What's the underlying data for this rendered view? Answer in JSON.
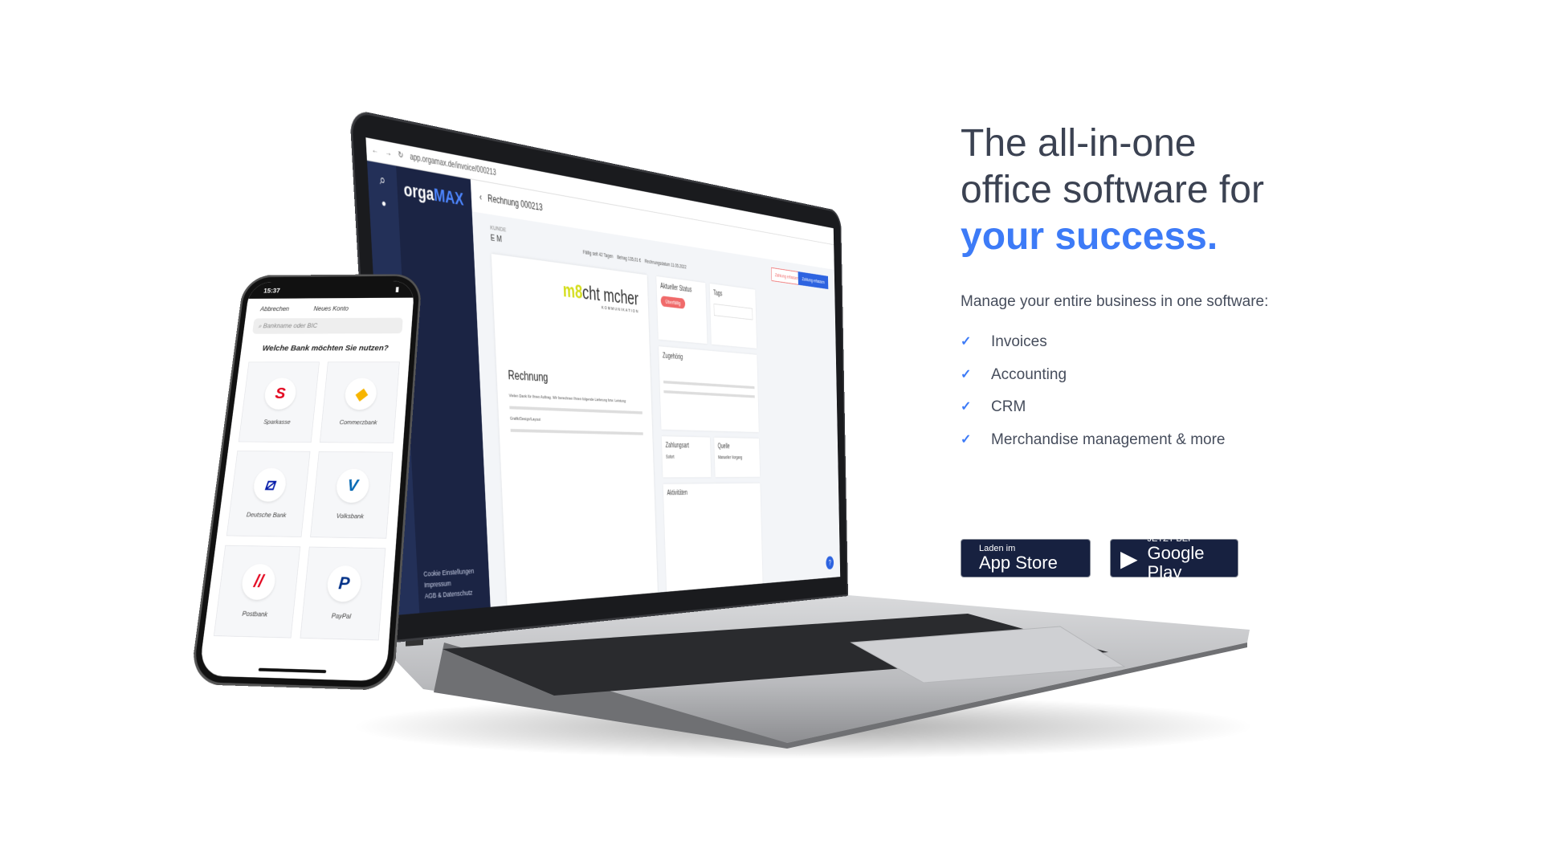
{
  "laptop": {
    "url": "app.orgamax.de/invoice/000213",
    "logo": {
      "part1": "orga",
      "part2": "MAX"
    },
    "page_title": "Rechnung 000213",
    "customer_label": "KUNDE",
    "customer": "E M",
    "meta": [
      "Fällig seit 42 Tagen",
      "Betrag 135,01 €",
      "Rechnungsdatum 11.05.2022"
    ],
    "doc_logo": {
      "part1": "m",
      "part2": "8",
      "part3": "cht mcher",
      "sub": "KOMMUNIKATION"
    },
    "doc_title": "Rechnung",
    "doc_text": "Vielen Dank für Ihren Auftrag. Wir berechnen Ihnen folgende Lieferung bzw. Leistung:",
    "doc_item": "Grafik/Design/Layout",
    "status_title": "Aktueller Status",
    "status_badge": "Überfällig",
    "tags_title": "Tags",
    "related_title": "Zugehörig",
    "payment_title": "Zahlungsart",
    "payment_value": "Sofort",
    "source_title": "Quelle",
    "source_value": "Manueller Vorgang",
    "activities_title": "Aktivitäten",
    "btn_secondary": "Zahlung erfassen",
    "btn_primary": "Zahlung erfassen",
    "footer_links": [
      "Cookie Einstellungen",
      "Impressum",
      "AGB & Datenschutz"
    ],
    "help": "?"
  },
  "phone": {
    "time": "15:37",
    "cancel": "Abbrechen",
    "title": "Neues Konto",
    "search_placeholder": "Bankname oder BIC",
    "question": "Welche Bank möchten Sie nutzen?",
    "banks": [
      {
        "name": "Sparkasse",
        "glyph": "S",
        "color": "#e2001a"
      },
      {
        "name": "Commerzbank",
        "glyph": "◆",
        "color": "#f7b500"
      },
      {
        "name": "Deutsche Bank",
        "glyph": "⧄",
        "color": "#0018a8"
      },
      {
        "name": "Volksbank",
        "glyph": "V",
        "color": "#0066b3"
      },
      {
        "name": "Postbank",
        "glyph": "//",
        "color": "#e2001a"
      },
      {
        "name": "PayPal",
        "glyph": "P",
        "color": "#003087"
      }
    ]
  },
  "hero": {
    "line1": "The all-in-one",
    "line2": "office software for",
    "accent": "your success.",
    "intro": "Manage your entire business in one software:",
    "features": [
      "Invoices",
      "Accounting",
      "CRM",
      "Merchandise management & more"
    ],
    "accent_color": "#3d7bf7"
  },
  "stores": {
    "apple": {
      "small": "Laden im",
      "big": "App Store"
    },
    "google": {
      "small": "JETZT BEI",
      "big": "Google Play"
    }
  }
}
